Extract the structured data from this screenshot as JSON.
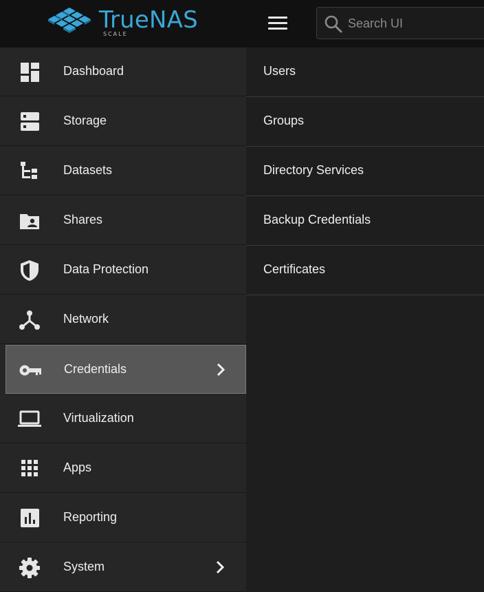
{
  "header": {
    "logo_text": "TrueNAS",
    "logo_sub": "SCALE",
    "search_placeholder": "Search UI"
  },
  "sidebar": {
    "items": [
      {
        "label": "Dashboard",
        "icon": "dashboard-icon"
      },
      {
        "label": "Storage",
        "icon": "storage-icon"
      },
      {
        "label": "Datasets",
        "icon": "datasets-icon"
      },
      {
        "label": "Shares",
        "icon": "shares-icon"
      },
      {
        "label": "Data Protection",
        "icon": "shield-icon"
      },
      {
        "label": "Network",
        "icon": "network-icon"
      },
      {
        "label": "Credentials",
        "icon": "key-icon",
        "active": true,
        "has_submenu": true
      },
      {
        "label": "Virtualization",
        "icon": "laptop-icon"
      },
      {
        "label": "Apps",
        "icon": "apps-grid-icon"
      },
      {
        "label": "Reporting",
        "icon": "reporting-icon"
      },
      {
        "label": "System",
        "icon": "gear-icon",
        "has_submenu": true
      }
    ]
  },
  "submenu": {
    "items": [
      {
        "label": "Users"
      },
      {
        "label": "Groups"
      },
      {
        "label": "Directory Services"
      },
      {
        "label": "Backup Credentials"
      },
      {
        "label": "Certificates"
      }
    ]
  },
  "colors": {
    "brand": "#3aa7d8",
    "sidebar_bg": "#262626",
    "active_bg": "#575757",
    "content_bg": "#1e1e1e"
  }
}
